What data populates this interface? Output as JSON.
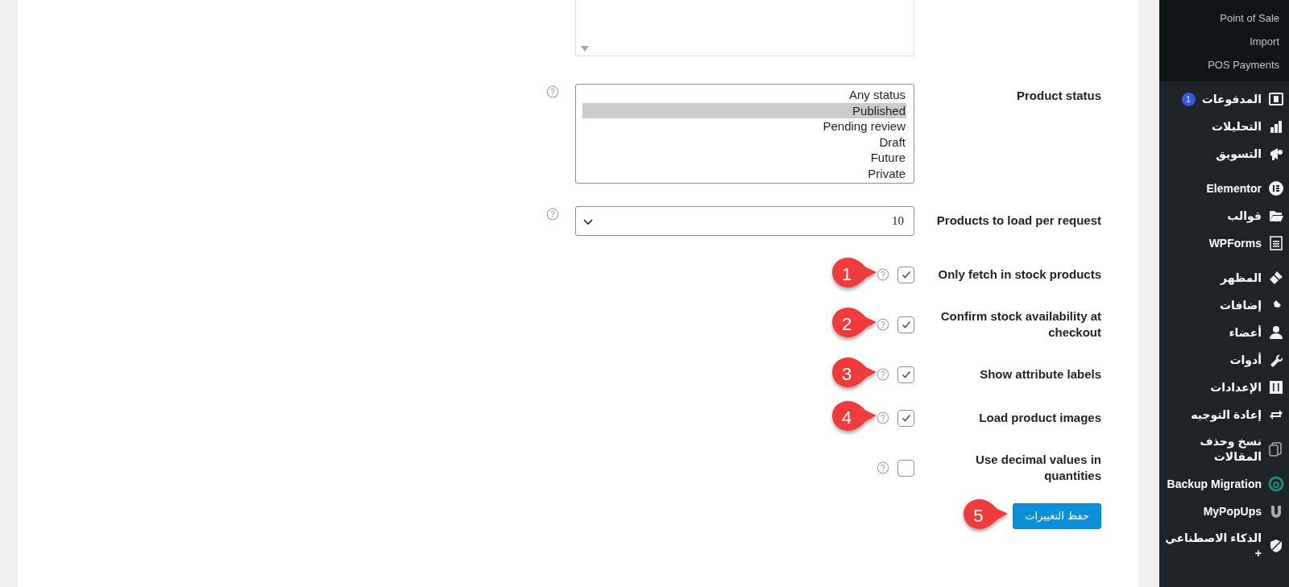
{
  "top_box": {
    "kind": "listbox"
  },
  "settings": [
    {
      "kind": "listbox",
      "label": "Product status",
      "options": [
        {
          "text": "Any status",
          "selected": false
        },
        {
          "text": "Published",
          "selected": true
        },
        {
          "text": "Pending review",
          "selected": false
        },
        {
          "text": "Draft",
          "selected": false
        },
        {
          "text": "Future",
          "selected": false
        },
        {
          "text": "Private",
          "selected": false
        }
      ]
    },
    {
      "kind": "select",
      "label": "Products to load per request",
      "value": "10"
    },
    {
      "kind": "checkbox",
      "label": "Only fetch in stock products",
      "checked": true,
      "marker": "1"
    },
    {
      "kind": "checkbox",
      "label": "Confirm stock availability at checkout",
      "checked": true,
      "marker": "2"
    },
    {
      "kind": "checkbox",
      "label": "Show attribute labels",
      "checked": true,
      "marker": "3"
    },
    {
      "kind": "checkbox",
      "label": "Load product images",
      "checked": true,
      "marker": "4"
    },
    {
      "kind": "checkbox",
      "label": "Use decimal values in quantities",
      "checked": false
    }
  ],
  "save_button": {
    "label": "حفظ التغييرات",
    "marker": "5"
  },
  "sidebar": {
    "submenu": [
      "Point of Sale",
      "Import",
      "POS Payments"
    ],
    "sections": [
      {
        "items": [
          {
            "label": "المدفوعات",
            "badge": "1"
          },
          {
            "label": "التحليلات"
          },
          {
            "label": "التسويق"
          }
        ]
      },
      {
        "items": [
          {
            "label": "Elementor"
          },
          {
            "label": "قوالب"
          },
          {
            "label": "WPForms"
          }
        ]
      },
      {
        "items": [
          {
            "label": "المظهر"
          },
          {
            "label": "إضافات"
          },
          {
            "label": "أعضاء"
          },
          {
            "label": "أدوات"
          },
          {
            "label": "الإعدادات"
          },
          {
            "label": "إعادة التوجيه"
          },
          {
            "label": "نسخ وحذف المقالات"
          },
          {
            "label": "Backup Migration"
          },
          {
            "label": "MyPopUps"
          },
          {
            "label": "الذكاء الاصطناعي +"
          }
        ]
      }
    ]
  }
}
